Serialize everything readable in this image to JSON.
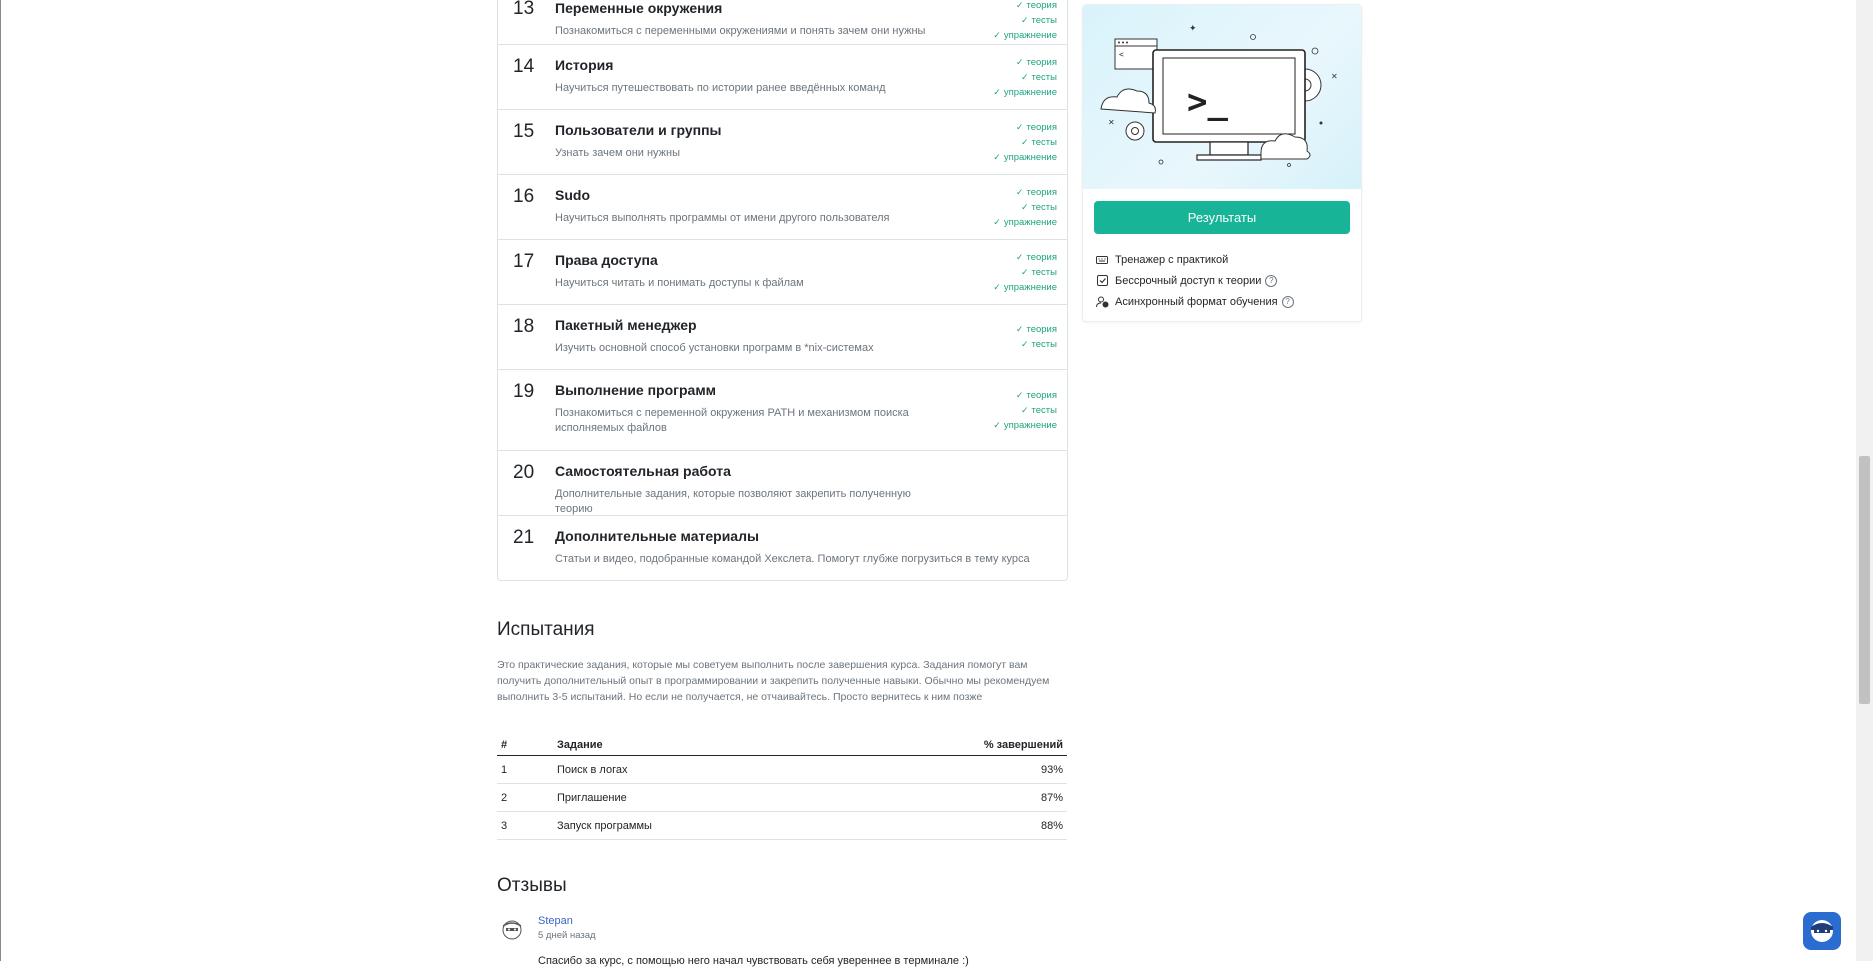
{
  "lessons": [
    {
      "num": "13",
      "title": "Переменные окружения",
      "desc": "Познакомиться с переменными окружениями и понять зачем они нужны",
      "marks": [
        "теория",
        "тесты",
        "упражнение"
      ]
    },
    {
      "num": "14",
      "title": "История",
      "desc": "Научиться путешествовать по истории ранее введённых команд",
      "marks": [
        "теория",
        "тесты",
        "упражнение"
      ]
    },
    {
      "num": "15",
      "title": "Пользователи и группы",
      "desc": "Узнать зачем они нужны",
      "marks": [
        "теория",
        "тесты",
        "упражнение"
      ]
    },
    {
      "num": "16",
      "title": "Sudo",
      "desc": "Научиться выполнять программы от имени другого пользователя",
      "marks": [
        "теория",
        "тесты",
        "упражнение"
      ]
    },
    {
      "num": "17",
      "title": "Права доступа",
      "desc": "Научиться читать и понимать доступы к файлам",
      "marks": [
        "теория",
        "тесты",
        "упражнение"
      ]
    },
    {
      "num": "18",
      "title": "Пакетный менеджер",
      "desc": "Изучить основной способ установки программ в *nix-системах",
      "marks": [
        "теория",
        "тесты"
      ]
    },
    {
      "num": "19",
      "title": "Выполнение программ",
      "desc": "Познакомиться с переменной окружения PATH и механизмом поиска исполняемых файлов",
      "marks": [
        "теория",
        "тесты",
        "упражнение"
      ]
    },
    {
      "num": "20",
      "title": "Самостоятельная работа",
      "desc": "Дополнительные задания, которые позволяют закрепить полученную теорию",
      "marks": []
    },
    {
      "num": "21",
      "title": "Дополнительные материалы",
      "desc": "Статьи и видео, подобранные командой Хекслета. Помогут глубже погрузиться в тему курса",
      "marks": []
    }
  ],
  "sidebar": {
    "results_label": "Результаты",
    "features": [
      {
        "icon": "keyboard-icon",
        "label": "Тренажер с практикой",
        "help": false
      },
      {
        "icon": "checkbox-icon",
        "label": "Бессрочный доступ к теории",
        "help": true
      },
      {
        "icon": "user-clock-icon",
        "label": "Асинхронный формат обучения",
        "help": true
      }
    ]
  },
  "challenges": {
    "title": "Испытания",
    "description": "Это практические задания, которые мы советуем выполнить после завершения курса. Задания помогут вам получить дополнительный опыт в программировании и закрепить полученные навыки. Обычно мы рекомендуем выполнить 3-5 испытаний. Но если не получается, не отчаивайтесь. Просто вернитесь к ним позже",
    "headers": {
      "num": "#",
      "task": "Задание",
      "pct": "% завершений"
    },
    "rows": [
      {
        "num": "1",
        "task": "Поиск в логах",
        "pct": "93%"
      },
      {
        "num": "2",
        "task": "Приглашение",
        "pct": "87%"
      },
      {
        "num": "3",
        "task": "Запуск программы",
        "pct": "88%"
      }
    ]
  },
  "reviews": {
    "title": "Отзывы",
    "items": [
      {
        "name": "Stepan",
        "date": "5 дней назад",
        "text": "Спасибо за курс, с помощью него начал чувствовать себя увереннее в терминале :)"
      }
    ]
  },
  "colors": {
    "accent": "#17b497",
    "check": "#1fa37f",
    "link": "#3a66c4",
    "chat": "#2b6cd1"
  },
  "icons": {
    "banner": "terminal-monitor-illustration",
    "chat": "hexlet-chat-icon"
  }
}
